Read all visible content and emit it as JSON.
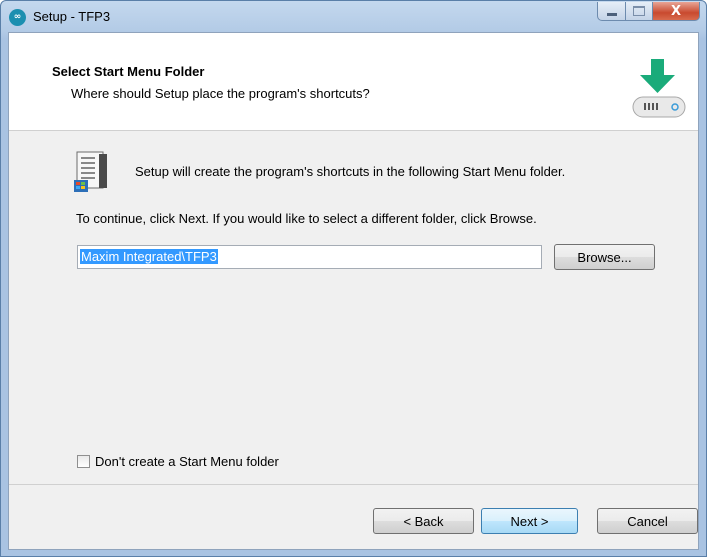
{
  "window": {
    "title": "Setup - TFP3",
    "app_icon_glyph": "∞",
    "close_glyph": "X"
  },
  "header": {
    "title": "Select Start Menu Folder",
    "subtitle": "Where should Setup place the program's shortcuts?",
    "icon": "download-drive-icon"
  },
  "body": {
    "description": "Setup will create the program's shortcuts in the following Start Menu folder.",
    "instructions": "To continue, click Next. If you would like to select a different folder, click Browse.",
    "folder_value": "Maxim Integrated\\TFP3",
    "browse_label": "Browse...",
    "no_folder_label": "Don't create a Start Menu folder",
    "no_folder_checked": false
  },
  "footer": {
    "back_label": "< Back",
    "next_label": "Next >",
    "cancel_label": "Cancel"
  },
  "colors": {
    "accent_green": "#1aab7a",
    "selection": "#3399ff",
    "app_icon": "#1b8fb0"
  }
}
